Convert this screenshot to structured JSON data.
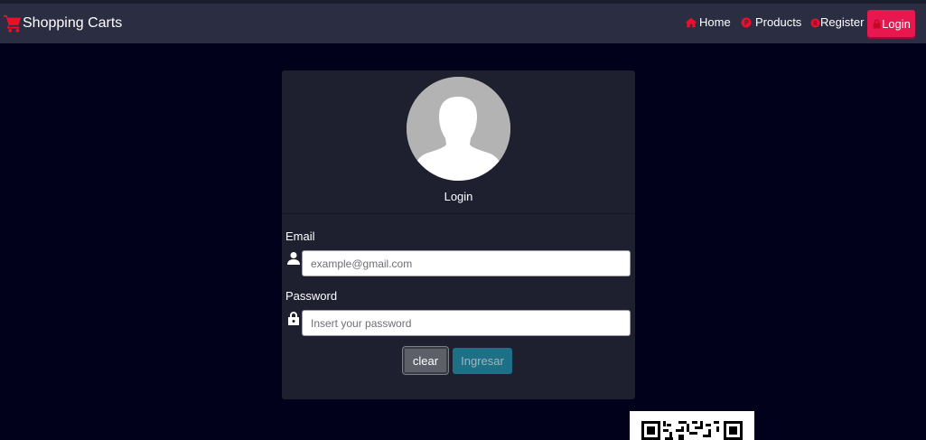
{
  "app": {
    "brand": "Shopping Carts"
  },
  "nav": {
    "home": "Home",
    "products": "Products",
    "register": "Register",
    "login": "Login"
  },
  "login_card": {
    "title": "Login",
    "email_label": "Email",
    "email_placeholder": "example@gmail.com",
    "email_value": "",
    "password_label": "Password",
    "password_placeholder": "Insert your password",
    "password_value": "",
    "clear_label": "clear",
    "submit_label": "Ingresar"
  },
  "colors": {
    "background": "#02011c",
    "navbar": "#2b2d42",
    "accent": "#e8174f",
    "card": "#1e1f2f",
    "submit_button": "#1d7085"
  },
  "icons": {
    "brand": "shopping-cart-icon",
    "home": "home-icon",
    "products": "circle-p-icon",
    "register": "circle-r-icon",
    "login": "lock-icon",
    "email_field": "user-icon",
    "password_field": "lock-icon"
  }
}
